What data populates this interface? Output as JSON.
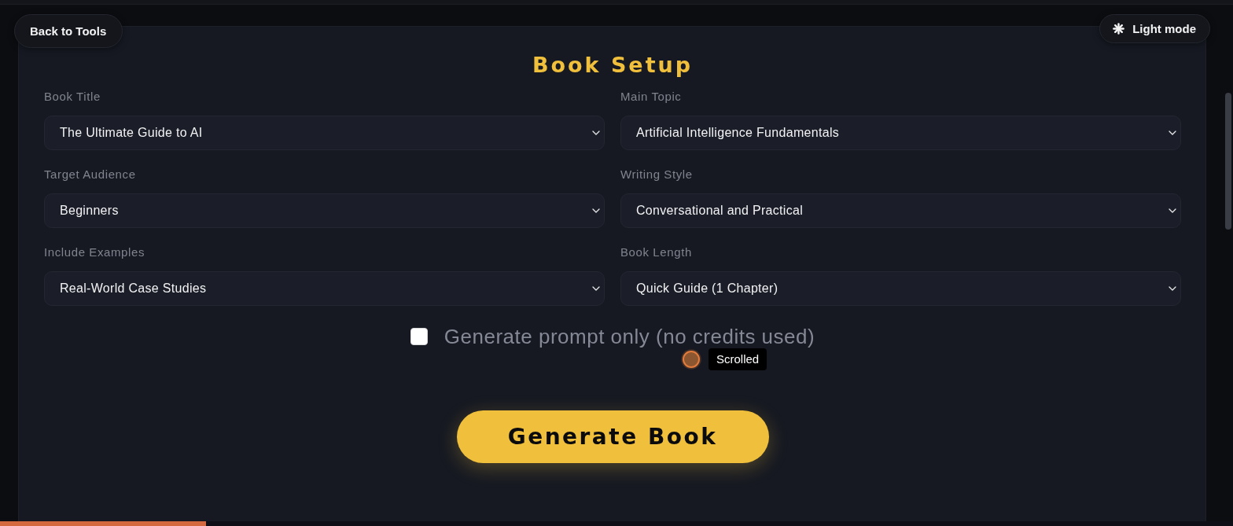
{
  "header": {
    "back_button": {
      "label": "Back to Tools"
    },
    "theme_toggle": {
      "label": "Light mode"
    }
  },
  "form": {
    "title": "Book Setup",
    "fields": [
      {
        "label": "Book Title",
        "value": "The Ultimate Guide to AI"
      },
      {
        "label": "Main Topic",
        "value": "Artificial Intelligence Fundamentals"
      },
      {
        "label": "Target Audience",
        "value": "Beginners"
      },
      {
        "label": "Writing Style",
        "value": "Conversational and Practical"
      },
      {
        "label": "Include Examples",
        "value": "Real-World Case Studies"
      },
      {
        "label": "Book Length",
        "value": "Quick Guide (1 Chapter)"
      }
    ],
    "prompt_only": {
      "label": "Generate prompt only (no credits used)",
      "checked": false
    },
    "submit": {
      "label": "Generate Book"
    }
  },
  "cursor_indicator": {
    "label": "Scrolled"
  },
  "reading_progress": {
    "level": 0.167
  }
}
